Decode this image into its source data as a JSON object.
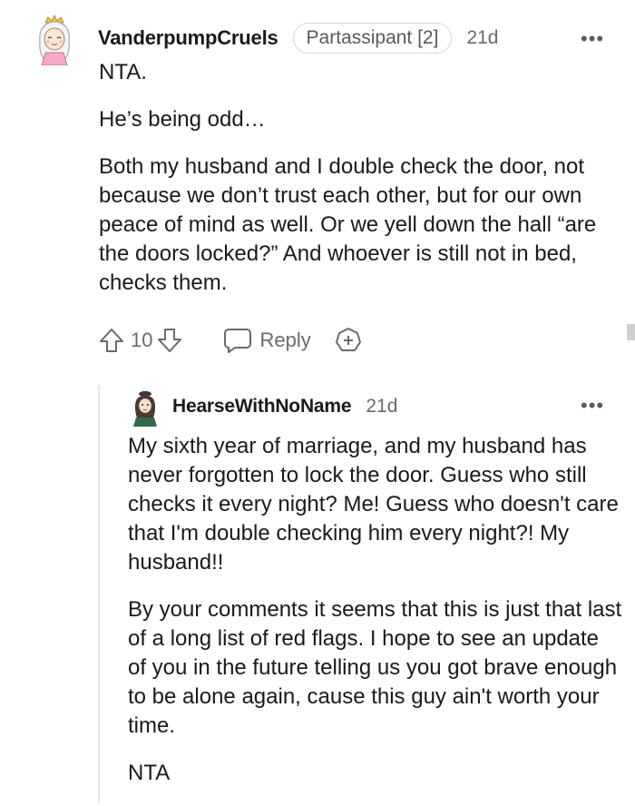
{
  "comment": {
    "username": "VanderpumpCruels",
    "flair": "Partassipant [2]",
    "time": "21d",
    "more_icon": "more-options-icon",
    "paragraphs": [
      "NTA.",
      "He’s being odd…",
      "Both my husband and I double check the door, not because we don’t trust each other, but for our own peace of mind as well. Or we yell down the hall “are the doors locked?” And whoever is still not in bed, checks them."
    ],
    "vote_count": "10",
    "reply_label": "Reply"
  },
  "reply": {
    "username": "HearseWithNoName",
    "time": "21d",
    "paragraphs": [
      "My sixth year of marriage, and my husband has never forgotten to lock the door. Guess who still checks it every night? Me! Guess who doesn't care that I'm double checking him every night?! My husband!!",
      "By your comments it seems that this is just that last of a long list of red flags. I hope to see an update of you in the future telling us you got brave enough to be alone again, cause this guy ain't worth your time.",
      "NTA"
    ]
  },
  "colors": {
    "text": "#1a1a1b",
    "meta": "#6a6a6a",
    "flair_border": "#d6d6d6",
    "thread_line": "#e6e6e6"
  }
}
